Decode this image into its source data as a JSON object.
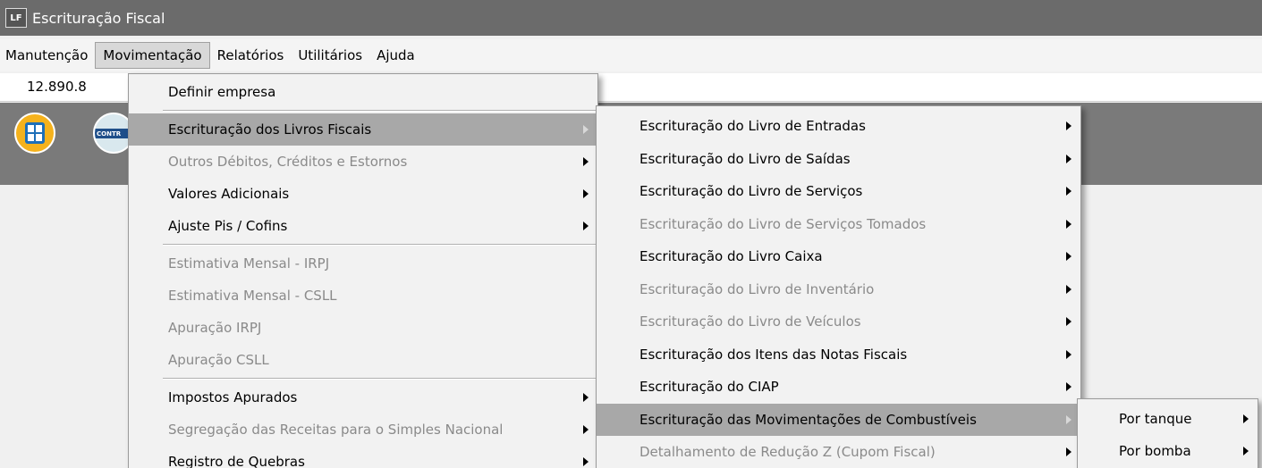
{
  "window": {
    "icon": "LF",
    "title": "Escrituração Fiscal"
  },
  "menubar": [
    "Manutenção",
    "Movimentação",
    "Relatórios",
    "Utilitários",
    "Ajuda"
  ],
  "infobar": {
    "value": "12.890.8"
  },
  "toolbar": {
    "icons": [
      "building-icon",
      "contr-icon"
    ],
    "contr_label": "CONTR"
  },
  "menu1": {
    "items": [
      {
        "label": "Definir empresa",
        "disabled": false,
        "submenu": false
      },
      {
        "label": "Escrituração dos Livros Fiscais",
        "disabled": false,
        "submenu": true,
        "highlight": true
      },
      {
        "label": "Outros Débitos, Créditos e Estornos",
        "disabled": true,
        "submenu": true
      },
      {
        "label": "Valores Adicionais",
        "disabled": false,
        "submenu": true
      },
      {
        "label": "Ajuste Pis / Cofins",
        "disabled": false,
        "submenu": true
      },
      {
        "label": "Estimativa Mensal - IRPJ",
        "disabled": true,
        "submenu": false
      },
      {
        "label": "Estimativa Mensal - CSLL",
        "disabled": true,
        "submenu": false
      },
      {
        "label": "Apuração IRPJ",
        "disabled": true,
        "submenu": false
      },
      {
        "label": "Apuração CSLL",
        "disabled": true,
        "submenu": false
      },
      {
        "label": "Impostos Apurados",
        "disabled": false,
        "submenu": true
      },
      {
        "label": "Segregação das Receitas para o Simples Nacional",
        "disabled": true,
        "submenu": true
      },
      {
        "label": "Registro de Quebras",
        "disabled": false,
        "submenu": true
      }
    ]
  },
  "menu2": {
    "items": [
      {
        "label": "Escrituração do Livro de Entradas",
        "disabled": false
      },
      {
        "label": "Escrituração do Livro de Saídas",
        "disabled": false
      },
      {
        "label": "Escrituração do Livro de Serviços",
        "disabled": false
      },
      {
        "label": "Escrituração do Livro de Serviços Tomados",
        "disabled": true
      },
      {
        "label": "Escrituração do Livro Caixa",
        "disabled": false
      },
      {
        "label": "Escrituração do Livro de Inventário",
        "disabled": true
      },
      {
        "label": "Escrituração do Livro de Veículos",
        "disabled": true
      },
      {
        "label": "Escrituração dos Itens das Notas Fiscais",
        "disabled": false
      },
      {
        "label": "Escrituração do CIAP",
        "disabled": false
      },
      {
        "label": "Escrituração das Movimentações de Combustíveis",
        "disabled": false,
        "highlight": true
      },
      {
        "label": "Detalhamento de Redução Z (Cupom Fiscal)",
        "disabled": true
      }
    ]
  },
  "menu3": {
    "items": [
      {
        "label": "Por tanque"
      },
      {
        "label": "Por bomba"
      }
    ]
  }
}
